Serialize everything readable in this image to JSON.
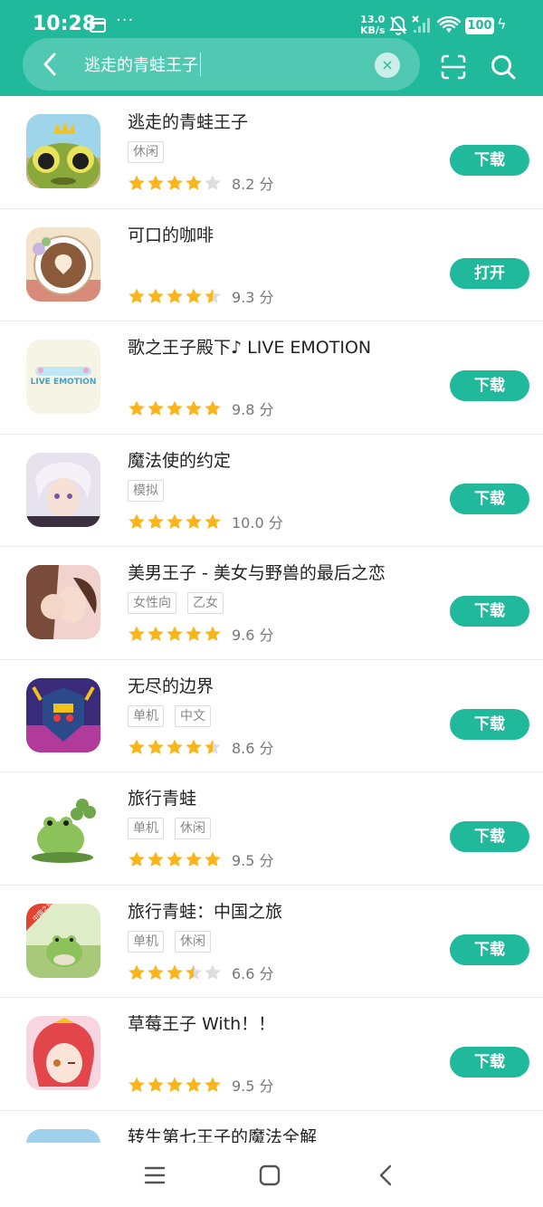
{
  "status_bar": {
    "time": "10:28",
    "dots": "···",
    "speed_value": "13.0",
    "speed_unit": "KB/s",
    "battery": "100",
    "bolt": "ϟ"
  },
  "search": {
    "query": "逃走的青蛙王子",
    "clear_symbol": "×"
  },
  "colors": {
    "accent": "#20b99c",
    "star": "#f9b51a",
    "star_empty": "#dddddd"
  },
  "apps": [
    {
      "name": "逃走的青蛙王子",
      "tags": [
        "休闲"
      ],
      "rating": 4,
      "score": "8.2 分",
      "action": "下载"
    },
    {
      "name": "可口的咖啡",
      "tags": [],
      "rating": 4.5,
      "score": "9.3 分",
      "action": "打开"
    },
    {
      "name": "歌之王子殿下♪ LIVE EMOTION",
      "tags": [],
      "rating": 5,
      "score": "9.8 分",
      "action": "下载",
      "icon_text": "LIVE EMOTION"
    },
    {
      "name": "魔法使的约定",
      "tags": [
        "模拟"
      ],
      "rating": 5,
      "score": "10.0 分",
      "action": "下载"
    },
    {
      "name": "美男王子 - 美女与野兽的最后之恋",
      "tags": [
        "女性向",
        "乙女"
      ],
      "rating": 5,
      "score": "9.6 分",
      "action": "下载"
    },
    {
      "name": "无尽的边界",
      "tags": [
        "单机",
        "中文"
      ],
      "rating": 4.5,
      "score": "8.6 分",
      "action": "下载"
    },
    {
      "name": "旅行青蛙",
      "tags": [
        "单机",
        "休闲"
      ],
      "rating": 5,
      "score": "9.5 分",
      "action": "下载"
    },
    {
      "name": "旅行青蛙：中国之旅",
      "tags": [
        "单机",
        "休闲"
      ],
      "rating": 3.5,
      "score": "6.6 分",
      "action": "下载",
      "icon_text": "中国之旅"
    },
    {
      "name": "草莓王子 With！！",
      "tags": [],
      "rating": 5,
      "score": "9.5 分",
      "action": "下载"
    }
  ],
  "partial_app": {
    "name": "转生第七王子的魔法全解"
  },
  "nav": {
    "icons": [
      "menu-icon",
      "home-icon",
      "back-icon"
    ]
  }
}
